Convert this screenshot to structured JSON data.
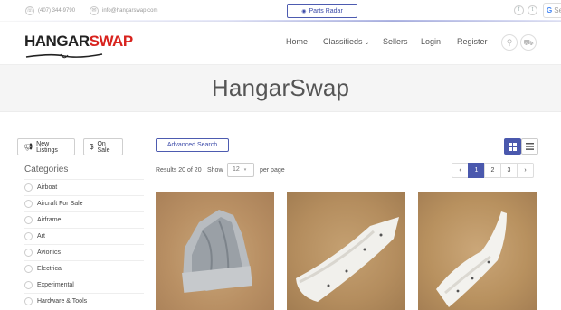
{
  "topbar": {
    "phone": "(407) 344-9790",
    "email": "info@hangarswap.com",
    "parts_radar": "Parts Radar",
    "google_label": "Se"
  },
  "logo": {
    "part1": "HANGAR",
    "part2": "SWAP"
  },
  "nav": {
    "home": "Home",
    "classifieds": "Classifieds",
    "sellers": "Sellers",
    "login": "Login",
    "register": "Register"
  },
  "hero": {
    "title": "HangarSwap"
  },
  "sidebar": {
    "new_listings": "New Listings",
    "on_sale": "On Sale",
    "categories_title": "Categories",
    "categories": [
      "Airboat",
      "Aircraft For Sale",
      "Airframe",
      "Art",
      "Avionics",
      "Electrical",
      "Experimental",
      "Hardware & Tools"
    ]
  },
  "toolbar": {
    "advanced_search": "Advanced Search",
    "results": "Results 20 of 20",
    "show": "Show",
    "per_page_value": "12",
    "per_page": "per page"
  },
  "pagination": {
    "prev": "‹",
    "pages": [
      "1",
      "2",
      "3"
    ],
    "next": "›",
    "active": "1"
  },
  "colors": {
    "accent": "#4a58ad",
    "logo_red": "#d8231e"
  }
}
